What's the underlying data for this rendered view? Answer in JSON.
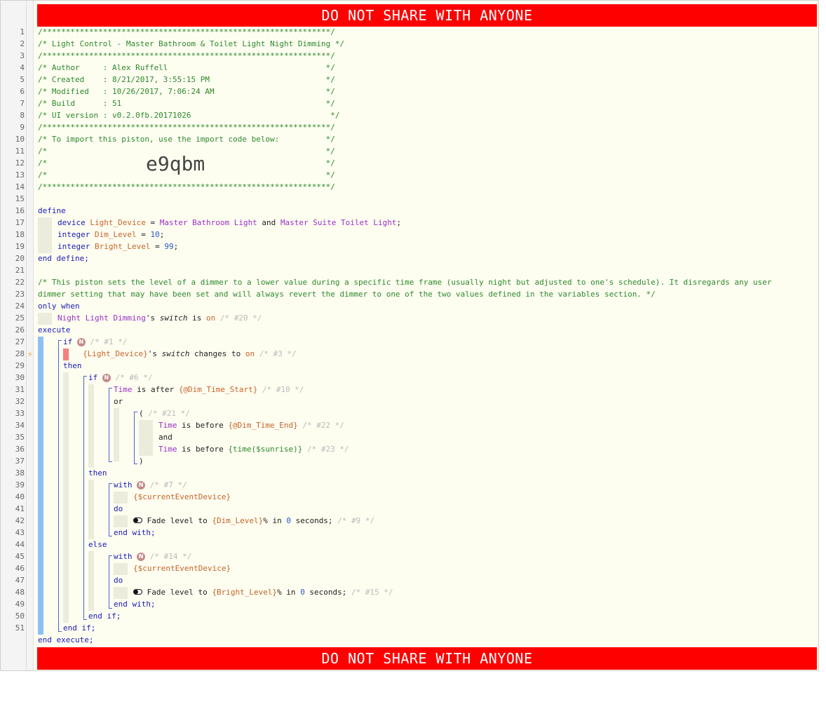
{
  "banner": {
    "top": "DO NOT SHARE WITH ANYONE",
    "bottom": "DO NOT SHARE WITH ANYONE"
  },
  "header": {
    "stars": "/**************************************************************/",
    "title_line": "/* Light Control - Master Bathroom & Toilet Light Night Dimming */",
    "author": "/* Author     : Alex Ruffell                                  */",
    "created": "/* Created    : 8/21/2017, 3:55:15 PM                         */",
    "modified": "/* Modified   : 10/26/2017, 7:06:24 AM                        */",
    "build": "/* Build      : 51                                            */",
    "ui_version": "/* UI version : v0.2.0fb.20171026                              */",
    "import_line": "/* To import this piston, use the import code below:          */",
    "blank_line": "/*                                                            */",
    "import_code": "e9qbm"
  },
  "code": {
    "define": "define",
    "device_kw": "device",
    "device_var": "Light_Device",
    "eq": " = ",
    "device_a": "Master Bathroom Light",
    "and_word": " and ",
    "device_b": "Master Suite Toilet Light",
    "semi": ";",
    "integer_kw": "integer",
    "dim_var": "Dim_Level",
    "dim_val": "10",
    "bright_var": "Bright_Level",
    "bright_val": "99",
    "end_define": "end define;",
    "description": "/* This piston sets the level of a dimmer to a lower value during a specific time frame (usually night but adjusted to one's schedule). It disregards any user",
    "description_2": "dimmer setting that may have been set and will always revert the dimmer to one of the two values defined in the variables section. */",
    "only_when": "only when",
    "nld_device": "Night Light Dimming",
    "poss": "'s ",
    "switch_attr": "switch",
    "is_word": " is ",
    "on_val": "on",
    "c20": " /* #20 */",
    "execute": "execute",
    "if_kw": "if",
    "n_badge": "N",
    "c1": " /* #1 */",
    "light_device_ref": "{Light_Device}",
    "changes_to": " changes to ",
    "c3": " /* #3 */",
    "then_kw": "then",
    "c6": " /* #6 */",
    "time_word": "Time",
    "is_after": " is after ",
    "dim_start": "{@Dim_Time_Start}",
    "c10": " /* #10 */",
    "or_kw": "or",
    "paren_open": "(",
    "c21": " /* #21 */",
    "is_before": " is before ",
    "dim_end": "{@Dim_Time_End}",
    "c22": " /* #22 */",
    "and_kw": "and",
    "sunrise": "{time($sunrise)}",
    "c23": " /* #23 */",
    "paren_close": ")",
    "with_kw": "with",
    "c7": " /* #7 */",
    "current_device": "{$currentEventDevice}",
    "do_kw": "do",
    "fade_text": " Fade level to ",
    "dim_ref": "{Dim_Level}",
    "pct_in": "% in ",
    "zero": "0",
    "seconds": " seconds;",
    "c9": " /* #9 */",
    "end_with": "end with;",
    "else_kw": "else",
    "c14": " /* #14 */",
    "bright_ref": "{Bright_Level}",
    "c15": " /* #15 */",
    "end_if": "end if;",
    "end_execute": "end execute;"
  },
  "line_numbers": [
    "1",
    "2",
    "3",
    "4",
    "5",
    "6",
    "7",
    "8",
    "9",
    "10",
    "11",
    "12",
    "13",
    "14",
    "15",
    "16",
    "17",
    "18",
    "19",
    "20",
    "21",
    "22",
    "23",
    "24",
    "25",
    "26",
    "27",
    "28",
    "29",
    "30",
    "31",
    "32",
    "33",
    "34",
    "35",
    "36",
    "37",
    "38",
    "39",
    "40",
    "41",
    "42",
    "43",
    "44",
    "45",
    "46",
    "47",
    "48",
    "49",
    "50",
    "51"
  ],
  "icons": {
    "trigger": "lightning-bolt-icon",
    "action": "toggle-switch-icon",
    "badge": "n-badge-icon"
  }
}
